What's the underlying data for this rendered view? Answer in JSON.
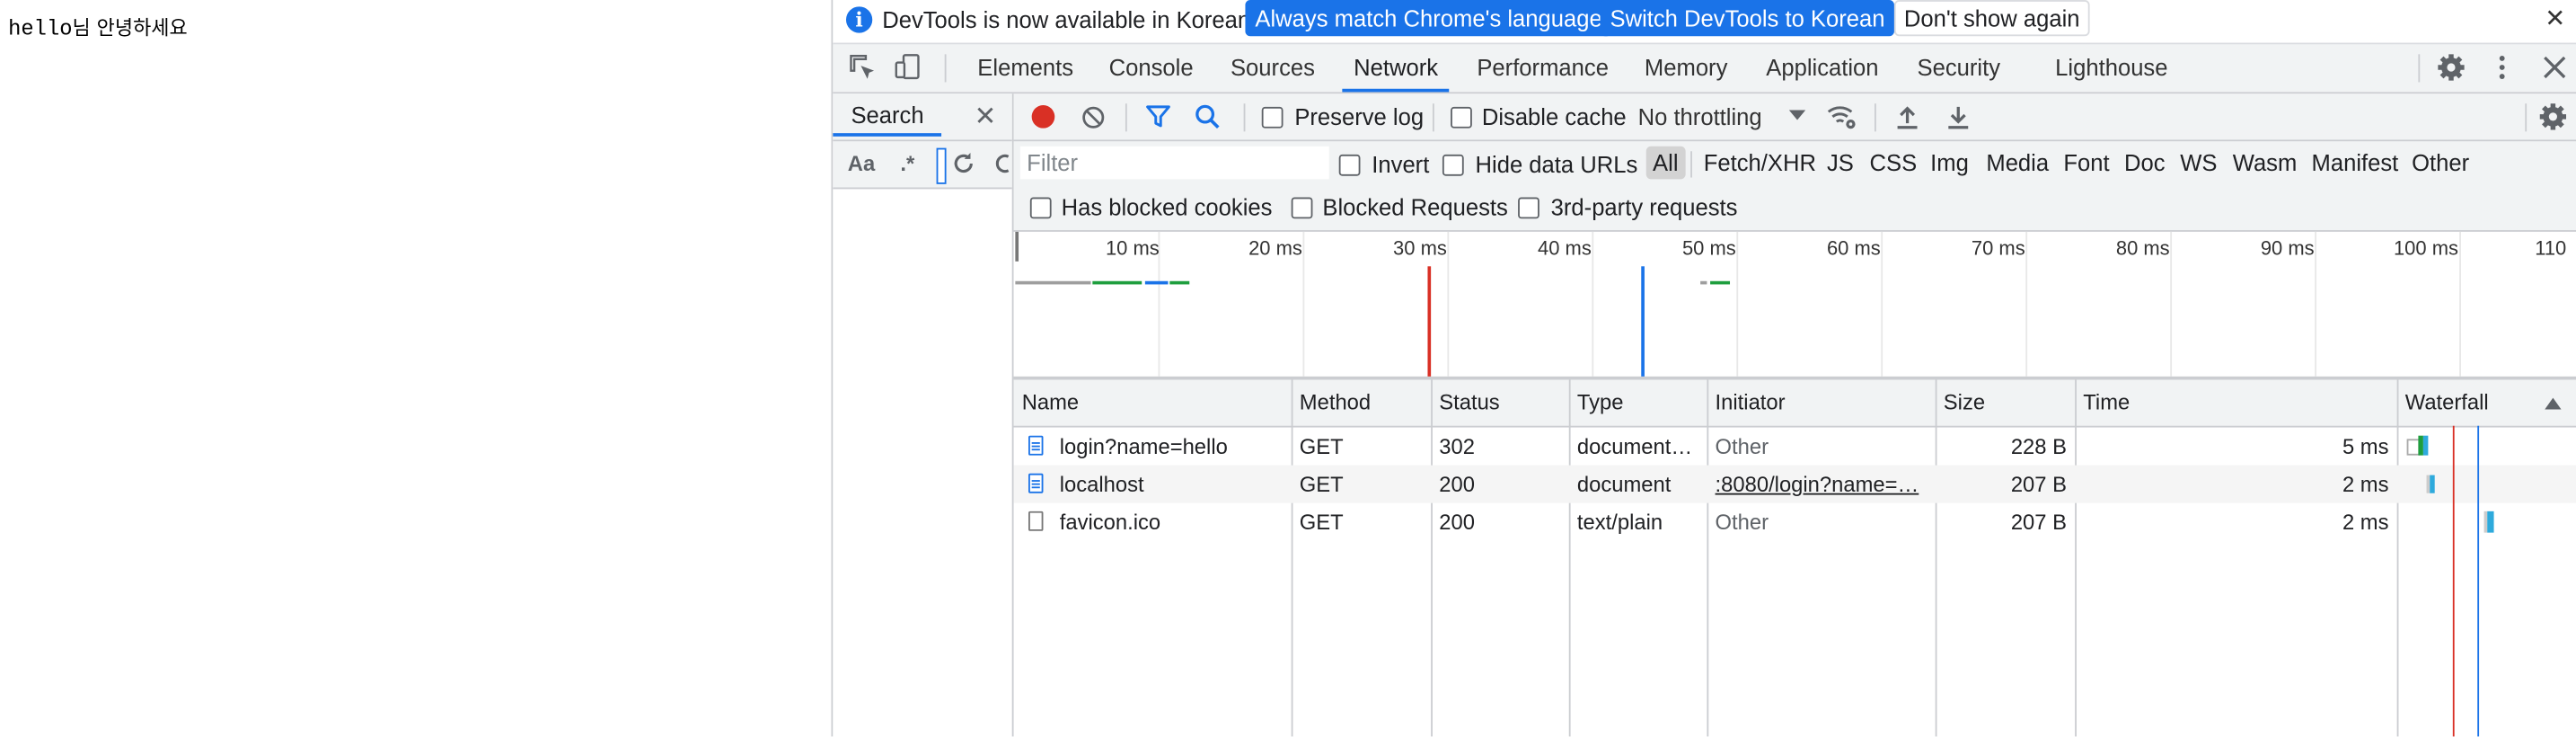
{
  "page": {
    "text_ascii": "hello",
    "text_korean": "님 안녕하세요"
  },
  "infobar": {
    "message": "DevTools is now available in Korean!",
    "btn_match": "Always match Chrome's language",
    "btn_switch": "Switch DevTools to Korean",
    "btn_dismiss": "Don't show again"
  },
  "tabs": [
    "Elements",
    "Console",
    "Sources",
    "Network",
    "Performance",
    "Memory",
    "Application",
    "Security",
    "Lighthouse"
  ],
  "active_tab": "Network",
  "search_panel": {
    "tab_label": "Search",
    "match_case": "Aa",
    "regex": ".*"
  },
  "toolbar": {
    "preserve_log": "Preserve log",
    "disable_cache": "Disable cache",
    "throttling": "No throttling"
  },
  "filter": {
    "placeholder": "Filter",
    "invert": "Invert",
    "hide_data_urls": "Hide data URLs",
    "types": [
      "All",
      "Fetch/XHR",
      "JS",
      "CSS",
      "Img",
      "Media",
      "Font",
      "Doc",
      "WS",
      "Wasm",
      "Manifest",
      "Other"
    ],
    "has_blocked_cookies": "Has blocked cookies",
    "blocked_requests": "Blocked Requests",
    "third_party": "3rd-party requests"
  },
  "overview": {
    "ticks": [
      "10 ms",
      "20 ms",
      "30 ms",
      "40 ms",
      "50 ms",
      "60 ms",
      "70 ms",
      "80 ms",
      "90 ms",
      "100 ms",
      "110"
    ]
  },
  "table": {
    "columns": [
      "Name",
      "Method",
      "Status",
      "Type",
      "Initiator",
      "Size",
      "Time",
      "Waterfall"
    ],
    "rows": [
      {
        "name": "login?name=hello",
        "method": "GET",
        "status": "302",
        "type": "document…",
        "initiator": "Other",
        "size": "228 B",
        "time": "5 ms"
      },
      {
        "name": "localhost",
        "method": "GET",
        "status": "200",
        "type": "document",
        "initiator": ":8080/login?name=…",
        "size": "207 B",
        "time": "2 ms"
      },
      {
        "name": "favicon.ico",
        "method": "GET",
        "status": "200",
        "type": "text/plain",
        "initiator": "Other",
        "size": "207 B",
        "time": "2 ms"
      }
    ]
  },
  "colors": {
    "accent": "#1a73e8",
    "record": "#d93025",
    "waterfall_bar": "#2eaadc"
  }
}
